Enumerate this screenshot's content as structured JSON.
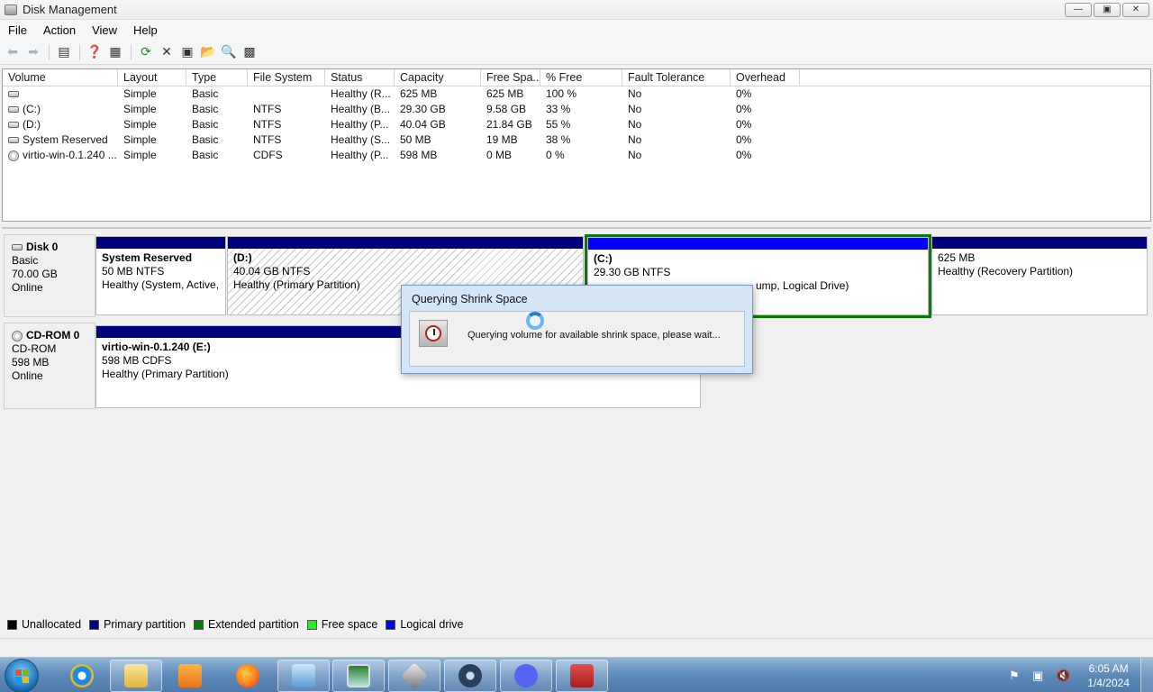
{
  "window": {
    "title": "Disk Management",
    "controls": [
      "—",
      "▣",
      "✕"
    ]
  },
  "menu": [
    "File",
    "Action",
    "View",
    "Help"
  ],
  "toolbar": {
    "icons": [
      "back-icon",
      "forward-icon",
      "console-tree-icon",
      "help-icon",
      "properties-icon",
      "refresh-icon",
      "delete-icon",
      "settings-icon",
      "open-folder-icon",
      "search-icon",
      "disk-icon"
    ]
  },
  "volume_list": {
    "columns": [
      "Volume",
      "Layout",
      "Type",
      "File System",
      "Status",
      "Capacity",
      "Free Spa...",
      "% Free",
      "Fault Tolerance",
      "Overhead"
    ],
    "rows": [
      {
        "volume": "",
        "layout": "Simple",
        "type": "Basic",
        "fs": "",
        "status": "Healthy (R...",
        "capacity": "625 MB",
        "free": "625 MB",
        "pct": "100 %",
        "fault": "No",
        "overhead": "0%"
      },
      {
        "volume": "(C:)",
        "layout": "Simple",
        "type": "Basic",
        "fs": "NTFS",
        "status": "Healthy (B...",
        "capacity": "29.30 GB",
        "free": "9.58 GB",
        "pct": "33 %",
        "fault": "No",
        "overhead": "0%"
      },
      {
        "volume": "(D:)",
        "layout": "Simple",
        "type": "Basic",
        "fs": "NTFS",
        "status": "Healthy (P...",
        "capacity": "40.04 GB",
        "free": "21.84 GB",
        "pct": "55 %",
        "fault": "No",
        "overhead": "0%"
      },
      {
        "volume": "System Reserved",
        "layout": "Simple",
        "type": "Basic",
        "fs": "NTFS",
        "status": "Healthy (S...",
        "capacity": "50 MB",
        "free": "19 MB",
        "pct": "38 %",
        "fault": "No",
        "overhead": "0%"
      },
      {
        "volume": "virtio-win-0.1.240 ...",
        "layout": "Simple",
        "type": "Basic",
        "fs": "CDFS",
        "status": "Healthy (P...",
        "capacity": "598 MB",
        "free": "0 MB",
        "pct": "0 %",
        "fault": "No",
        "overhead": "0%"
      }
    ]
  },
  "disks": [
    {
      "name": "Disk 0",
      "type": "Basic",
      "size": "70.00 GB",
      "state": "Online",
      "partitions": [
        {
          "title": "System Reserved",
          "line2": "50 MB NTFS",
          "line3": "Healthy (System, Active,"
        },
        {
          "title": "(D:)",
          "line2": "40.04 GB NTFS",
          "line3": "Healthy (Primary Partition)"
        },
        {
          "title": "(C:)",
          "line2": "29.30 GB NTFS",
          "line3": "ump, Logical Drive)"
        },
        {
          "title": "",
          "line2": "625 MB",
          "line3": "Healthy (Recovery Partition)"
        }
      ]
    },
    {
      "name": "CD-ROM 0",
      "type": "CD-ROM",
      "size": "598 MB",
      "state": "Online",
      "partitions": [
        {
          "title": "virtio-win-0.1.240  (E:)",
          "line2": "598 MB CDFS",
          "line3": "Healthy (Primary Partition)"
        }
      ]
    }
  ],
  "legend": [
    {
      "label": "Unallocated",
      "color": "#000000"
    },
    {
      "label": "Primary partition",
      "color": "#00007c"
    },
    {
      "label": "Extended partition",
      "color": "#0b7a0b"
    },
    {
      "label": "Free space",
      "color": "#22ee22"
    },
    {
      "label": "Logical drive",
      "color": "#0000ff"
    }
  ],
  "dialog": {
    "title": "Querying Shrink Space",
    "message": "Querying volume for available shrink space, please wait..."
  },
  "taskbar": {
    "apps": [
      "internet-explorer-icon",
      "file-explorer-icon",
      "media-player-icon",
      "firefox-icon",
      "control-panel-icon",
      "screen-icon",
      "rocket-icon",
      "steam-icon",
      "discord-icon",
      "toolbox-icon"
    ],
    "time": "6:05 AM",
    "date": "1/4/2024"
  }
}
